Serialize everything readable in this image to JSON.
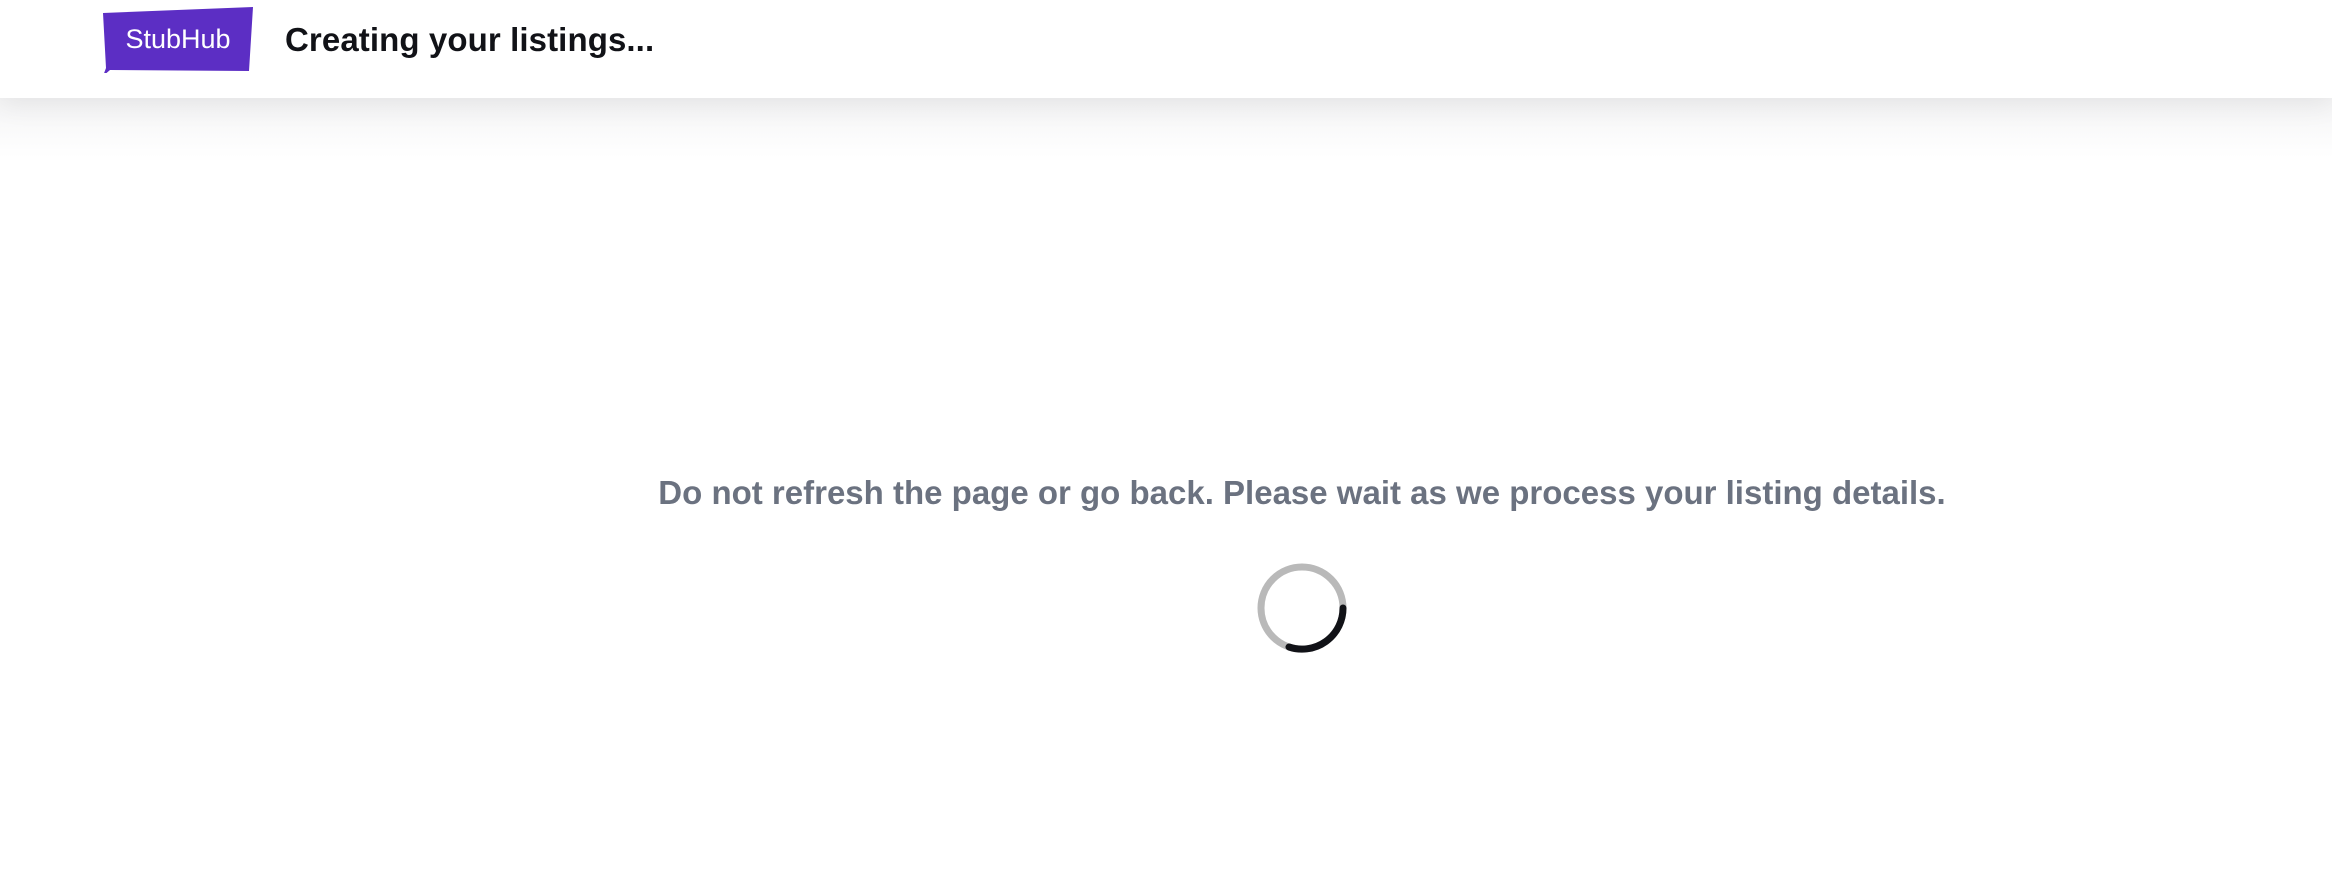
{
  "header": {
    "logo_text": "StubHub",
    "title": "Creating your listings..."
  },
  "main": {
    "message": "Do not refresh the page or go back. Please wait as we process your listing details."
  },
  "icons": {
    "logo": "stubhub-logo",
    "loading": "loading-spinner-icon"
  },
  "colors": {
    "brand": "#5c2ec4",
    "message_text": "#6b7280",
    "spinner_track": "#b9b9b9",
    "spinner_arc": "#111217"
  }
}
